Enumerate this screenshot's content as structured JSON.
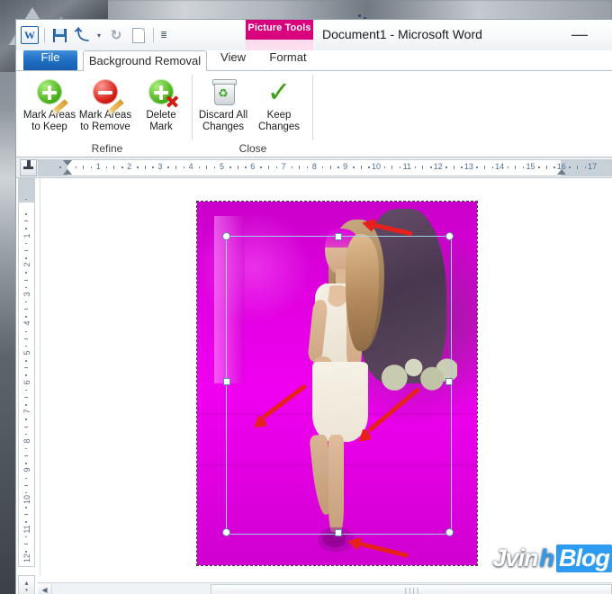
{
  "window": {
    "title": "Document1  -  Microsoft Word",
    "minimize_label": "—",
    "contextual_tab_group": "Picture Tools",
    "contextual_accent": "#d9007e"
  },
  "quick_access": {
    "items": [
      {
        "name": "word-logo",
        "glyph": "W"
      },
      {
        "name": "save-icon",
        "glyph": "save"
      },
      {
        "name": "undo-icon",
        "glyph": "undo"
      },
      {
        "name": "undo-dropdown-icon",
        "glyph": "▾"
      },
      {
        "name": "redo-icon",
        "glyph": "redo"
      },
      {
        "name": "new-document-icon",
        "glyph": "new"
      },
      {
        "name": "customize-qat-icon",
        "glyph": "▾"
      }
    ]
  },
  "tabs": [
    {
      "id": "file",
      "label": "File",
      "active": false
    },
    {
      "id": "background-removal",
      "label": "Background Removal",
      "active": true
    },
    {
      "id": "view",
      "label": "View",
      "active": false
    },
    {
      "id": "format",
      "label": "Format",
      "active": false
    }
  ],
  "ribbon": {
    "groups": [
      {
        "id": "refine",
        "label": "Refine",
        "buttons": [
          {
            "id": "mark-areas-to-keep",
            "label": "Mark Areas\nto Keep",
            "icon": "green-plus-pencil-icon"
          },
          {
            "id": "mark-areas-to-remove",
            "label": "Mark Areas\nto Remove",
            "icon": "red-minus-pencil-icon"
          },
          {
            "id": "delete-mark",
            "label": "Delete\nMark",
            "icon": "green-plus-red-x-icon"
          }
        ]
      },
      {
        "id": "close",
        "label": "Close",
        "buttons": [
          {
            "id": "discard-all-changes",
            "label": "Discard All\nChanges",
            "icon": "recycle-bin-icon"
          },
          {
            "id": "keep-changes",
            "label": "Keep\nChanges",
            "icon": "green-check-icon"
          }
        ]
      }
    ]
  },
  "rulers": {
    "tab_selector": "left-tab-stop",
    "horizontal_numbers": [
      1,
      2,
      3,
      4,
      5,
      6,
      7,
      8,
      9,
      10,
      11,
      12,
      13,
      14,
      15,
      16,
      17
    ],
    "vertical_numbers": [
      1,
      2,
      3,
      4,
      5,
      6,
      7,
      8,
      9,
      10,
      11,
      12
    ],
    "unit": "inches"
  },
  "document": {
    "picture": {
      "name": "selected-picture",
      "state": "background-removal-preview",
      "removal_overlay_color": "#e000e0",
      "selection_color": "#9fd0e6",
      "annotation_arrow_color": "#e8201c",
      "annotation_arrow_count": 4,
      "handles": [
        "top-left",
        "top-center",
        "top-right",
        "middle-left",
        "middle-right",
        "bottom-left",
        "bottom-center",
        "bottom-right"
      ]
    }
  },
  "scrollbars": {
    "horizontal_left_arrow": "◀",
    "horizontal_grip": "||||",
    "vertical_page_up": "▴",
    "vertical_page_dot": "•"
  },
  "watermark": {
    "part1": "Jvin",
    "part2": "h",
    "part3": "Blog",
    "accent": "#2d9cf0"
  }
}
